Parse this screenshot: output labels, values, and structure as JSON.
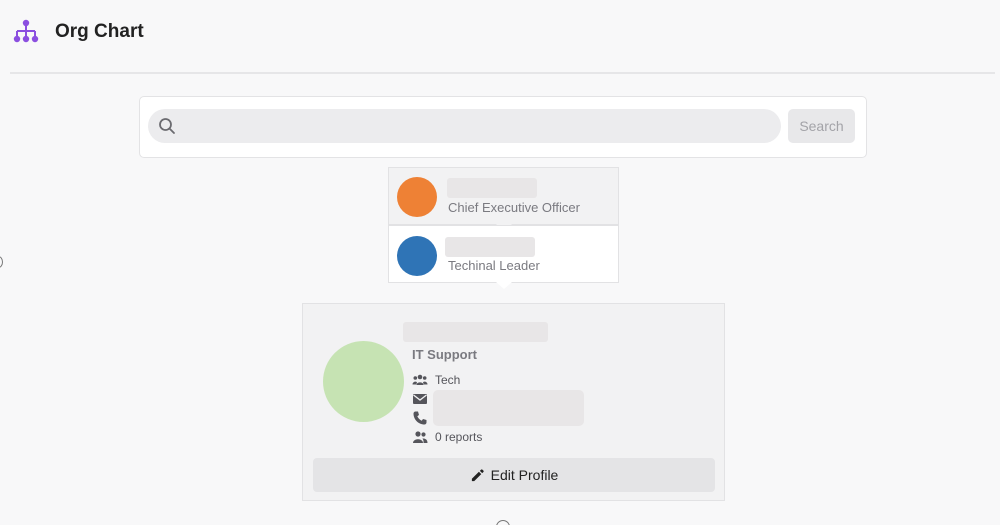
{
  "header": {
    "title": "Org Chart",
    "logo_icon": "org-chart-icon",
    "accent_color": "#8b4fe0"
  },
  "search": {
    "placeholder": "",
    "value": "",
    "button_label": "Search"
  },
  "nodes": [
    {
      "role": "Chief Executive Officer",
      "avatar_color": "#ee8135"
    },
    {
      "role": "Techinal Leader",
      "avatar_color": "#2f74b6"
    }
  ],
  "profile": {
    "job_title": "IT Support",
    "department": "Tech",
    "reports": "0 reports",
    "avatar_color": "#c6e3b3",
    "edit_label": "Edit Profile"
  }
}
